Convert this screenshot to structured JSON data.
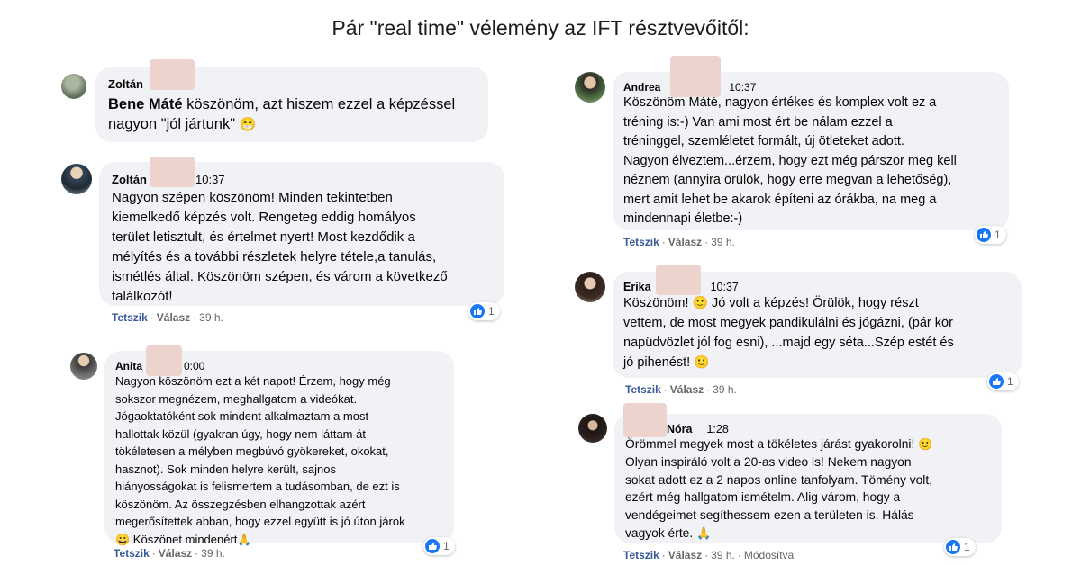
{
  "page": {
    "title": "Pár \"real time\" vélemény az IFT résztvevőitől:"
  },
  "comments": [
    {
      "author": "Zoltán",
      "time": "",
      "mention": "Bene Máté",
      "text": " köszönöm, azt hiszem ezzel a képzéssel\nnagyon \"jól jártunk\"",
      "emoji": "😁",
      "like_label": "",
      "reply_label": "",
      "age": "",
      "edited": "",
      "reactions": ""
    },
    {
      "author": "Zoltán",
      "time": "10:37",
      "text": "Nagyon szépen köszönöm! Minden tekintetben\nkiemelkedő képzés volt. Rengeteg eddig homályos\nterület letisztult, és értelmet nyert! Most kezdődik a\nmélyítés és a további részletek helyre tétele,a tanulás,\nismétlés által. Köszönöm szépen, és várom a következő\ntalálkozót!",
      "like_label": "Tetszik",
      "reply_label": "Válasz",
      "age": "39 h.",
      "reactions": "1"
    },
    {
      "author": "Anita",
      "time": "0:00",
      "text": "Nagyon köszönöm ezt a két napot! Érzem, hogy még\nsokszor megnézem, meghallgatom a videókat.\nJógaoktatóként sok mindent alkalmaztam a most\nhallottak közül (gyakran úgy, hogy nem láttam át\ntökéletesen a mélyben megbúvó gyökereket, okokat,\nhasznot). Sok minden helyre került, sajnos\nhiányosságokat is felismertem a tudásomban, de ezt is\nköszönöm. Az összegzésben elhangzottak azért\nmegerősítettek abban, hogy ezzel együtt is jó úton járok\n",
      "emoji_mid": "😀",
      "text_end": " Köszönet mindenért",
      "emoji_end": "🙏",
      "like_label": "Tetszik",
      "reply_label": "Válasz",
      "age": "39 h.",
      "reactions": "1"
    },
    {
      "author": "Andrea",
      "time": "10:37",
      "text": "Köszönöm Máté, nagyon értékes és komplex volt ez a\ntréning is:-) Van ami most ért be nálam ezzel a\ntréninggel, szemléletet formált, új ötleteket adott.\nNagyon élveztem...érzem, hogy ezt még párszor meg kell\nnéznem (annyira örülök, hogy erre megvan a lehetőség),\nmert amit lehet be akarok építeni az órákba, na meg a\nmindennapi életbe:-)",
      "like_label": "Tetszik",
      "reply_label": "Válasz",
      "age": "39 h.",
      "reactions": "1"
    },
    {
      "author": "Erika",
      "time": "10:37",
      "text_start": "Köszönöm! ",
      "emoji_start": "🙂",
      "text": " Jó volt a képzés! Örülök, hogy részt\nvettem, de most megyek pandikulálni és jógázni, (pár kör\nnapüdvözlet jól fog esni), ...majd egy séta...Szép estét és\njó pihenést! ",
      "emoji_end": "🙂",
      "like_label": "Tetszik",
      "reply_label": "Válasz",
      "age": "39 h.",
      "reactions": "1"
    },
    {
      "author": "Nóra",
      "time": "1:28",
      "text": "Örömmel megyek most a tökéletes járást gyakorolni! ",
      "emoji_mid": "🙂",
      "text2": "\nOlyan inspiráló volt a 20-as video is! Nekem nagyon\nsokat adott ez a 2 napos online tanfolyam. Tömény volt,\nezért még hallgatom ismételm. Alig várom, hogy a\nvendégeimet segíthessem ezen a területen is. Hálás\nvagyok érte. ",
      "emoji_end": "🙏",
      "like_label": "Tetszik",
      "reply_label": "Válasz",
      "age": "39 h.",
      "edited": "Módosítva",
      "reactions": "1"
    }
  ]
}
